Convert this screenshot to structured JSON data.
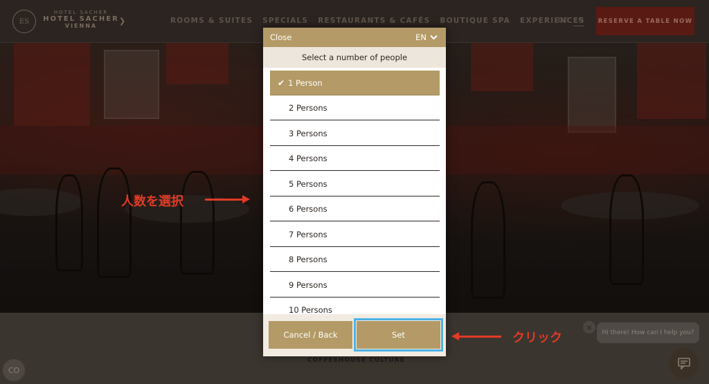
{
  "header": {
    "logo_emblem": "ES",
    "logo_line1": "HOTEL SACHER",
    "logo_line2": "HOTEL SACHER",
    "logo_line3": "VIENNA",
    "nav": [
      "ROOMS & SUITES",
      "SPECIALS",
      "RESTAURANTS & CAFÉS",
      "BOUTIQUE SPA",
      "EXPERIENCES"
    ],
    "lang_de": "DE",
    "lang_en": "EN",
    "reserve_label": "RESERVE A TABLE NOW"
  },
  "modal": {
    "close_label": "Close",
    "language": "EN",
    "subtitle": "Select a number of people",
    "options": [
      "1 Person",
      "2 Persons",
      "3 Persons",
      "4 Persons",
      "5 Persons",
      "6 Persons",
      "7 Persons",
      "8 Persons",
      "9 Persons",
      "10 Persons"
    ],
    "selected_index": 0,
    "cancel_label": "Cancel / Back",
    "set_label": "Set"
  },
  "page": {
    "section_label": "COFFEEHOUSE CULTURE",
    "chat_prompt": "Hi there! How can I help you?"
  },
  "annotations": {
    "select_people": "人数を選択",
    "click": "クリック"
  },
  "icons": {
    "chevron": "chevron-down-icon",
    "check": "check-icon",
    "chat": "chat-icon",
    "cookie": "cookie-settings-icon"
  },
  "colors": {
    "gold": "#b39a66",
    "highlight": "#4ab3e8",
    "annotation": "#e23a25"
  }
}
